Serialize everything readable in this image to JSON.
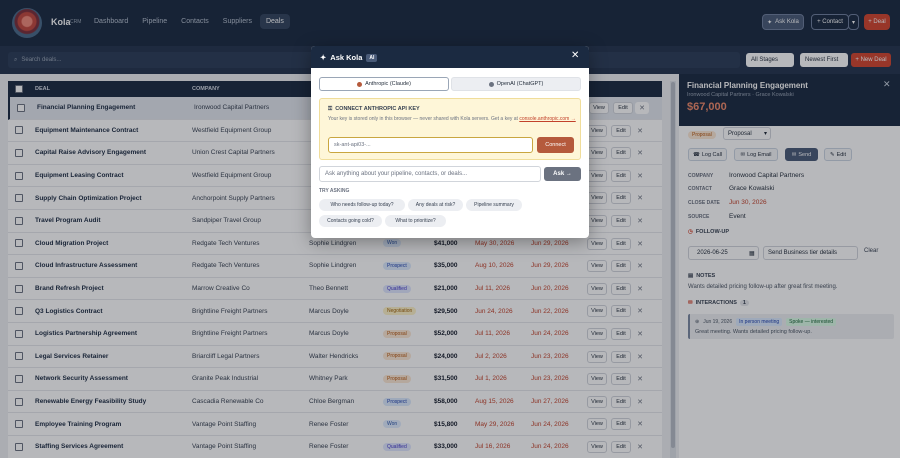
{
  "app": {
    "brand": "Kola",
    "brand_sub": "CRM"
  },
  "nav": [
    {
      "label": "Dashboard",
      "active": false
    },
    {
      "label": "Pipeline",
      "active": false
    },
    {
      "label": "Contacts",
      "active": false
    },
    {
      "label": "Suppliers",
      "active": false
    },
    {
      "label": "Deals",
      "active": true
    }
  ],
  "toolbar": {
    "ask_label": "Ask Kola",
    "contact_label": "+ Contact",
    "deal_label": "+ Deal"
  },
  "filters": {
    "search_placeholder": "Search deals...",
    "stage": "All Stages",
    "sort": "Newest First",
    "new_deal": "+ New Deal"
  },
  "table": {
    "headers": {
      "deal": "DEAL",
      "company": "COMPANY"
    },
    "rows": [
      {
        "deal": "Financial Planning Engagement",
        "company": "Ironwood Capital Partners",
        "contact": "",
        "stage": "",
        "stage_class": "",
        "value": "",
        "close": "",
        "created": "",
        "selected": true
      },
      {
        "deal": "Equipment Maintenance Contract",
        "company": "Westfield Equipment Group",
        "contact": "",
        "stage": "",
        "stage_class": "",
        "value": "",
        "close": "",
        "created": "",
        "selected": false
      },
      {
        "deal": "Capital Raise Advisory Engagement",
        "company": "Union Crest Capital Partners",
        "contact": "",
        "stage": "",
        "stage_class": "",
        "value": "",
        "close": "",
        "created": "",
        "selected": false
      },
      {
        "deal": "Equipment Leasing Contract",
        "company": "Westfield Equipment Group",
        "contact": "",
        "stage": "",
        "stage_class": "",
        "value": "",
        "close": "",
        "created": "",
        "selected": false
      },
      {
        "deal": "Supply Chain Optimization Project",
        "company": "Anchorpoint Supply Partners",
        "contact": "",
        "stage": "",
        "stage_class": "",
        "value": "",
        "close": "",
        "created": "",
        "selected": false
      },
      {
        "deal": "Travel Program Audit",
        "company": "Sandpiper Travel Group",
        "contact": "",
        "stage": "",
        "stage_class": "",
        "value": "",
        "close": "",
        "created": "",
        "selected": false
      },
      {
        "deal": "Cloud Migration Project",
        "company": "Redgate Tech Ventures",
        "contact": "Sophie Lindgren",
        "stage": "Won",
        "stage_class": "st-won",
        "value": "$41,000",
        "close": "May 30, 2026",
        "created": "Jun 29, 2026",
        "selected": false
      },
      {
        "deal": "Cloud Infrastructure Assessment",
        "company": "Redgate Tech Ventures",
        "contact": "Sophie Lindgren",
        "stage": "Prospect",
        "stage_class": "st-prospect",
        "value": "$35,000",
        "close": "Aug 10, 2026",
        "created": "Jun 29, 2026",
        "selected": false
      },
      {
        "deal": "Brand Refresh Project",
        "company": "Marrow Creative Co",
        "contact": "Theo Bennett",
        "stage": "Qualified",
        "stage_class": "st-qualified",
        "value": "$21,000",
        "close": "Jul 11, 2026",
        "created": "Jun 20, 2026",
        "selected": false
      },
      {
        "deal": "Q3 Logistics Contract",
        "company": "Brightline Freight Partners",
        "contact": "Marcus Doyle",
        "stage": "Negotiation",
        "stage_class": "st-negotiation",
        "value": "$29,500",
        "close": "Jun 24, 2026",
        "created": "Jun 22, 2026",
        "selected": false
      },
      {
        "deal": "Logistics Partnership Agreement",
        "company": "Brightline Freight Partners",
        "contact": "Marcus Doyle",
        "stage": "Proposal",
        "stage_class": "st-proposal",
        "value": "$52,000",
        "close": "Jul 11, 2026",
        "created": "Jun 24, 2026",
        "selected": false
      },
      {
        "deal": "Legal Services Retainer",
        "company": "Briarcliff Legal Partners",
        "contact": "Walter Hendricks",
        "stage": "Proposal",
        "stage_class": "st-proposal",
        "value": "$24,000",
        "close": "Jul 2, 2026",
        "created": "Jun 23, 2026",
        "selected": false
      },
      {
        "deal": "Network Security Assessment",
        "company": "Granite Peak Industrial",
        "contact": "Whitney Park",
        "stage": "Proposal",
        "stage_class": "st-proposal",
        "value": "$31,500",
        "close": "Jul 1, 2026",
        "created": "Jun 23, 2026",
        "selected": false
      },
      {
        "deal": "Renewable Energy Feasibility Study",
        "company": "Cascadia Renewable Co",
        "contact": "Chloe Bergman",
        "stage": "Prospect",
        "stage_class": "st-prospect",
        "value": "$58,000",
        "close": "Aug 15, 2026",
        "created": "Jun 27, 2026",
        "selected": false
      },
      {
        "deal": "Employee Training Program",
        "company": "Vantage Point Staffing",
        "contact": "Renee Foster",
        "stage": "Won",
        "stage_class": "st-won",
        "value": "$15,800",
        "close": "May 29, 2026",
        "created": "Jun 24, 2026",
        "selected": false
      },
      {
        "deal": "Staffing Services Agreement",
        "company": "Vantage Point Staffing",
        "contact": "Renee Foster",
        "stage": "Qualified",
        "stage_class": "st-qualified",
        "value": "$33,000",
        "close": "Jul 16, 2026",
        "created": "Jun 24, 2026",
        "selected": false
      }
    ],
    "view_label": "View",
    "edit_label": "Edit"
  },
  "panel": {
    "title": "Financial Planning Engagement",
    "subtitle": "Ironwood Capital Partners · Grace Kowalski",
    "value": "$67,000",
    "stage_badge": "Proposal",
    "stage_select": "Proposal",
    "actions": {
      "call": "Log Call",
      "email": "Log Email",
      "send": "Send",
      "edit": "Edit"
    },
    "fields": [
      {
        "key": "COMPANY",
        "value": "Ironwood Capital Partners",
        "red": false
      },
      {
        "key": "CONTACT",
        "value": "Grace Kowalski",
        "red": false
      },
      {
        "key": "CLOSE DATE",
        "value": "Jun 30, 2026",
        "red": true
      },
      {
        "key": "SOURCE",
        "value": "Event",
        "red": false
      }
    ],
    "followup": {
      "title": "FOLLOW-UP",
      "date": "2026-06-25",
      "note": "Send Business tier details",
      "clear": "Clear"
    },
    "notes": {
      "title": "NOTES",
      "text": "Wants detailed pricing follow-up after great first meeting."
    },
    "interactions": {
      "title": "INTERACTIONS",
      "count": "1",
      "item_date": "Jun 19, 2026",
      "item_type": "In person meeting",
      "item_tag": "Spoke — interested",
      "item_text": "Great meeting. Wants detailed pricing follow-up."
    }
  },
  "modal": {
    "title": "Ask Kola",
    "badge": "AI",
    "providers": {
      "anthropic": "Anthropic (Claude)",
      "openai": "OpenAI (ChatGPT)"
    },
    "key_title": "CONNECT ANTHROPIC API KEY",
    "key_text": "Your key is stored only in this browser — never shared with Kola servers.",
    "key_link_prefix": "Get a key at",
    "key_link": "console.anthropic.com →",
    "key_placeholder": "sk-ant-api03-...",
    "connect": "Connect",
    "ask_placeholder": "Ask anything about your pipeline, contacts, or deals...",
    "ask_button": "Ask →",
    "try_asking": "TRY ASKING",
    "suggestions": [
      "Who needs follow-up today?",
      "Any deals at risk?",
      "Pipeline summary",
      "Contacts going cold?",
      "What to prioritize?"
    ]
  }
}
